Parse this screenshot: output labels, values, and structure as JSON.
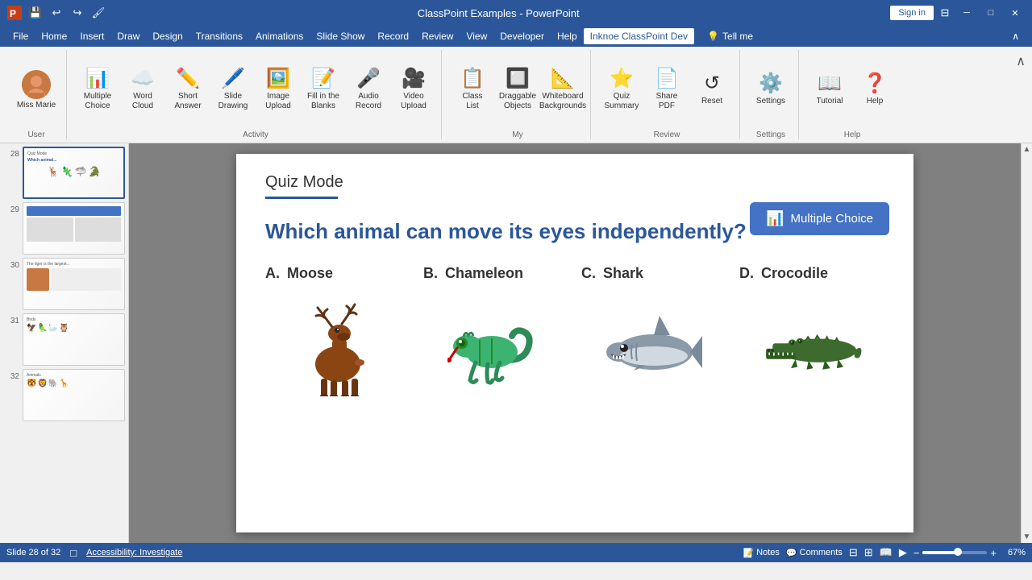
{
  "titlebar": {
    "title": "ClassPoint Examples - PowerPoint",
    "sign_in": "Sign in",
    "icons": [
      "save",
      "undo",
      "redo",
      "format-painter",
      "customize"
    ]
  },
  "menubar": {
    "items": [
      "File",
      "Home",
      "Insert",
      "Draw",
      "Design",
      "Transitions",
      "Animations",
      "Slide Show",
      "Record",
      "Review",
      "View",
      "Developer",
      "Help"
    ],
    "active": "Inknoe ClassPoint Dev",
    "tell_me": "Tell me"
  },
  "ribbon": {
    "user": {
      "name": "Miss Marie"
    },
    "activity_group": {
      "label": "Activity",
      "buttons": [
        {
          "id": "multiple-choice",
          "label": "Multiple\nChoice",
          "icon": "📊"
        },
        {
          "id": "word-cloud",
          "label": "Word\nCloud",
          "icon": "☁️"
        },
        {
          "id": "short-answer",
          "label": "Short\nAnswer",
          "icon": "✏️"
        },
        {
          "id": "slide-drawing",
          "label": "Slide\nDrawing",
          "icon": "🖊️"
        },
        {
          "id": "image-upload",
          "label": "Image\nUpload",
          "icon": "🖼️"
        },
        {
          "id": "fill-blanks",
          "label": "Fill in the\nBlanks",
          "icon": "📝"
        },
        {
          "id": "audio-record",
          "label": "Audio\nRecord",
          "icon": "🎤"
        },
        {
          "id": "video-upload",
          "label": "Video\nUpload",
          "icon": "🎥"
        }
      ]
    },
    "my_group": {
      "label": "My",
      "buttons": [
        {
          "id": "class-list",
          "label": "Class\nList",
          "icon": "📋"
        },
        {
          "id": "draggable-objects",
          "label": "Draggable\nObjects",
          "icon": "🔲"
        },
        {
          "id": "whiteboard-backgrounds",
          "label": "Whiteboard\nBackgrounds",
          "icon": "📐"
        }
      ]
    },
    "review_group": {
      "label": "Review",
      "buttons": [
        {
          "id": "quiz-summary",
          "label": "Quiz\nSummary",
          "icon": "⭐"
        },
        {
          "id": "share-pdf",
          "label": "Share\nPDF",
          "icon": "📄"
        },
        {
          "id": "reset",
          "label": "Reset",
          "icon": "↺"
        }
      ]
    },
    "settings_group": {
      "label": "Settings",
      "buttons": [
        {
          "id": "settings",
          "label": "Settings",
          "icon": "⚙️"
        }
      ]
    },
    "help_group": {
      "label": "Help",
      "buttons": [
        {
          "id": "tutorial",
          "label": "Tutorial",
          "icon": "📖"
        },
        {
          "id": "help",
          "label": "Help",
          "icon": "❓"
        }
      ]
    }
  },
  "slides": [
    {
      "num": 28,
      "active": true
    },
    {
      "num": 29,
      "active": false
    },
    {
      "num": 30,
      "active": false
    },
    {
      "num": 31,
      "active": false
    },
    {
      "num": 32,
      "active": false
    }
  ],
  "slide": {
    "quiz_mode_label": "Quiz Mode",
    "question": "Which animal can move its eyes independently?",
    "multiple_choice_label": "Multiple Choice",
    "answers": [
      {
        "letter": "A.",
        "name": "Moose",
        "emoji": "🦌"
      },
      {
        "letter": "B.",
        "name": "Chameleon",
        "emoji": "🦎"
      },
      {
        "letter": "C.",
        "name": "Shark",
        "emoji": "🦈"
      },
      {
        "letter": "D.",
        "name": "Crocodile",
        "emoji": "🐊"
      }
    ]
  },
  "statusbar": {
    "slide_info": "Slide 28 of 32",
    "accessibility": "Accessibility: Investigate",
    "notes": "Notes",
    "comments": "Comments",
    "zoom": "67%"
  }
}
